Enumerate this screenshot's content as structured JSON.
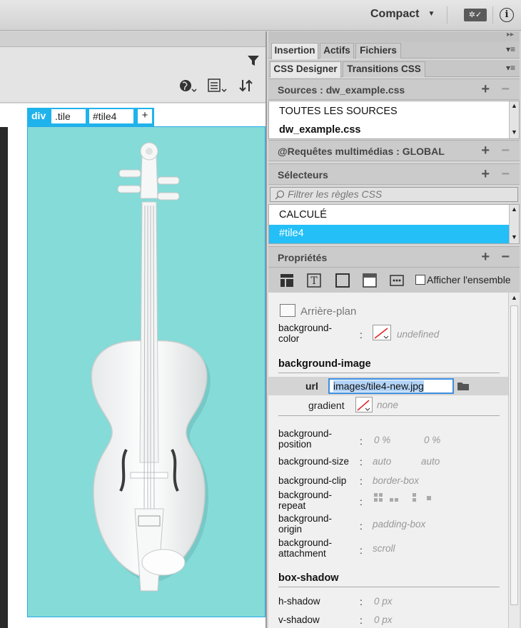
{
  "topbar": {
    "workspace_label": "Compact"
  },
  "doc": {
    "tag_label": "div",
    "class_tag": ".tile",
    "id_tag": "#tile4",
    "add_tag": "+"
  },
  "panel": {
    "tabs_row1": [
      "Insertion",
      "Actifs",
      "Fichiers"
    ],
    "tabs_row2": [
      "CSS Designer",
      "Transitions CSS"
    ],
    "sources": {
      "title": "Sources : dw_example.css",
      "items": [
        "TOUTES LES SOURCES",
        "dw_example.css"
      ]
    },
    "media": {
      "title": "@Requêtes multimédias : GLOBAL"
    },
    "selectors": {
      "title": "Sélecteurs",
      "filter_placeholder": "Filtrer les règles CSS",
      "items": [
        "CALCULÉ",
        "#tile4"
      ]
    },
    "properties": {
      "title": "Propriétés",
      "show_all_label": "Afficher l'ensemble",
      "background_group": "Arrière-plan",
      "bg_color_label_1": "background-",
      "bg_color_label_2": "color",
      "bg_color_value": "undefined",
      "bg_image_heading": "background-image",
      "url_label": "url",
      "url_value": "images/tile4-new.jpg",
      "gradient_label": "gradient",
      "gradient_value": "none",
      "rows": [
        {
          "l1": "background-",
          "l2": "position",
          "v1": "0 %",
          "v2": "0 %"
        },
        {
          "l1": "background-size",
          "l2": "",
          "v1": "auto",
          "v2": "auto"
        },
        {
          "l1": "background-clip",
          "l2": "",
          "v1": "border-box",
          "v2": ""
        },
        {
          "l1": "background-",
          "l2": "repeat",
          "v1": "",
          "v2": ""
        },
        {
          "l1": "background-",
          "l2": "origin",
          "v1": "padding-box",
          "v2": ""
        },
        {
          "l1": "background-",
          "l2": "attachment",
          "v1": "scroll",
          "v2": ""
        }
      ],
      "box_shadow_heading": "box-shadow",
      "h_shadow_label": "h-shadow",
      "h_shadow_value": "0 px",
      "v_shadow_label": "v-shadow",
      "v_shadow_value": "0 px"
    }
  },
  "colors": {
    "selection": "#23bff6",
    "tag_bar": "#1fb3ec",
    "tile_background": "#84dbd8"
  }
}
